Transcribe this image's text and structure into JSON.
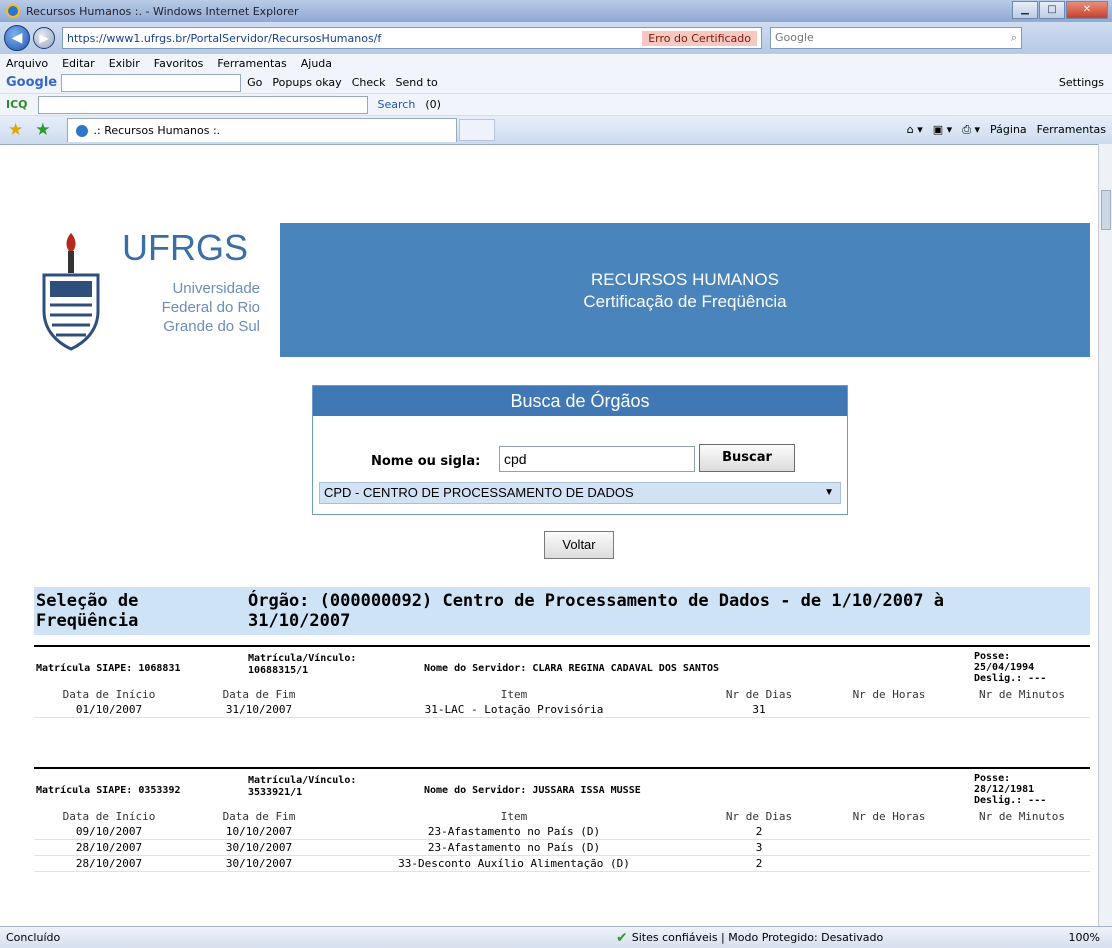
{
  "window": {
    "title": "Recursos Humanos :. - Windows Internet Explorer"
  },
  "address": {
    "url": "https://www1.ufrgs.br/PortalServidor/RecursosHumanos/f",
    "cert_error": "Erro do Certificado",
    "search_placeholder": "Google"
  },
  "menu": [
    "Arquivo",
    "Editar",
    "Exibir",
    "Favoritos",
    "Ferramentas",
    "Ajuda"
  ],
  "google_toolbar": {
    "go": "Go",
    "popups": "Popups okay",
    "check": "Check",
    "send": "Send to",
    "settings": "Settings"
  },
  "icq_toolbar": {
    "icq": "ICQ",
    "search": "Search",
    "count": "(0)"
  },
  "tab": {
    "label": ".: Recursos Humanos :."
  },
  "commands": {
    "pagina": "Página",
    "ferramentas": "Ferramentas"
  },
  "header": {
    "ufrgs": "UFRGS",
    "univ_lines": [
      "Universidade",
      "Federal do Rio",
      "Grande do Sul"
    ],
    "banner_lines": [
      "RECURSOS HUMANOS",
      "Certificação de Freqüência"
    ]
  },
  "busca": {
    "title": "Busca de Órgãos",
    "label": "Nome ou sigla:",
    "value": "cpd",
    "button": "Buscar",
    "selected": "CPD - CENTRO DE PROCESSAMENTO DE DADOS"
  },
  "voltar": "Voltar",
  "selecao": {
    "left": "Seleção de Freqüência",
    "right": "Órgão: (000000092) Centro de Processamento de Dados - de 1/10/2007 à 31/10/2007"
  },
  "columns": [
    "Data de Início",
    "Data de Fim",
    "Item",
    "Nr de Dias",
    "Nr de Horas",
    "Nr de Minutos"
  ],
  "records": [
    {
      "siape": "Matrícula SIAPE: 1068831",
      "mv_label": "Matrícula/Vínculo:",
      "mv_value": "10688315/1",
      "nome": "Nome do Servidor: CLARA REGINA CADAVAL DOS SANTOS",
      "posse": "Posse:",
      "posse_date": "25/04/1994",
      "deslig": "Deslig.: ---",
      "rows": [
        [
          "01/10/2007",
          "31/10/2007",
          "31-LAC - Lotação Provisória",
          "31",
          "",
          ""
        ]
      ]
    },
    {
      "siape": "Matrícula SIAPE: 0353392",
      "mv_label": "Matrícula/Vínculo:",
      "mv_value": "3533921/1",
      "nome": "Nome do Servidor: JUSSARA ISSA MUSSE",
      "posse": "Posse:",
      "posse_date": "28/12/1981",
      "deslig": "Deslig.: ---",
      "rows": [
        [
          "09/10/2007",
          "10/10/2007",
          "23-Afastamento no País (D)",
          "2",
          "",
          ""
        ],
        [
          "28/10/2007",
          "30/10/2007",
          "23-Afastamento no País (D)",
          "3",
          "",
          ""
        ],
        [
          "28/10/2007",
          "30/10/2007",
          "33-Desconto Auxílio Alimentação (D)",
          "2",
          "",
          ""
        ]
      ]
    }
  ],
  "status": {
    "done": "Concluído",
    "zone": "Sites confiáveis | Modo Protegido: Desativado",
    "zoom": "100%"
  }
}
